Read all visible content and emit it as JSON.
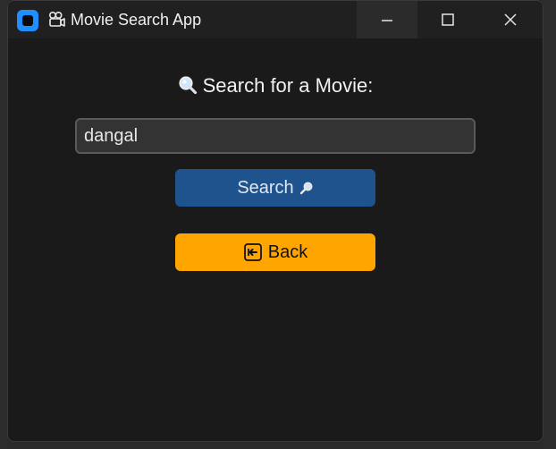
{
  "window": {
    "title": "Movie Search App",
    "title_icon": "movie-camera-icon",
    "app_icon": "app-icon"
  },
  "main": {
    "prompt": "Search for a Movie:",
    "prompt_icon": "magnifier-icon",
    "search_value": "dangal",
    "search_button_label": "Search",
    "search_button_icon": "magnifier-icon",
    "back_button_label": "Back",
    "back_button_icon": "back-arrow-icon"
  },
  "colors": {
    "window_bg": "#1a1a1a",
    "titlebar_bg": "#202020",
    "input_bg": "#333333",
    "search_button": "#1f538d",
    "back_button": "#ffa500",
    "app_icon": "#1f8fff"
  }
}
